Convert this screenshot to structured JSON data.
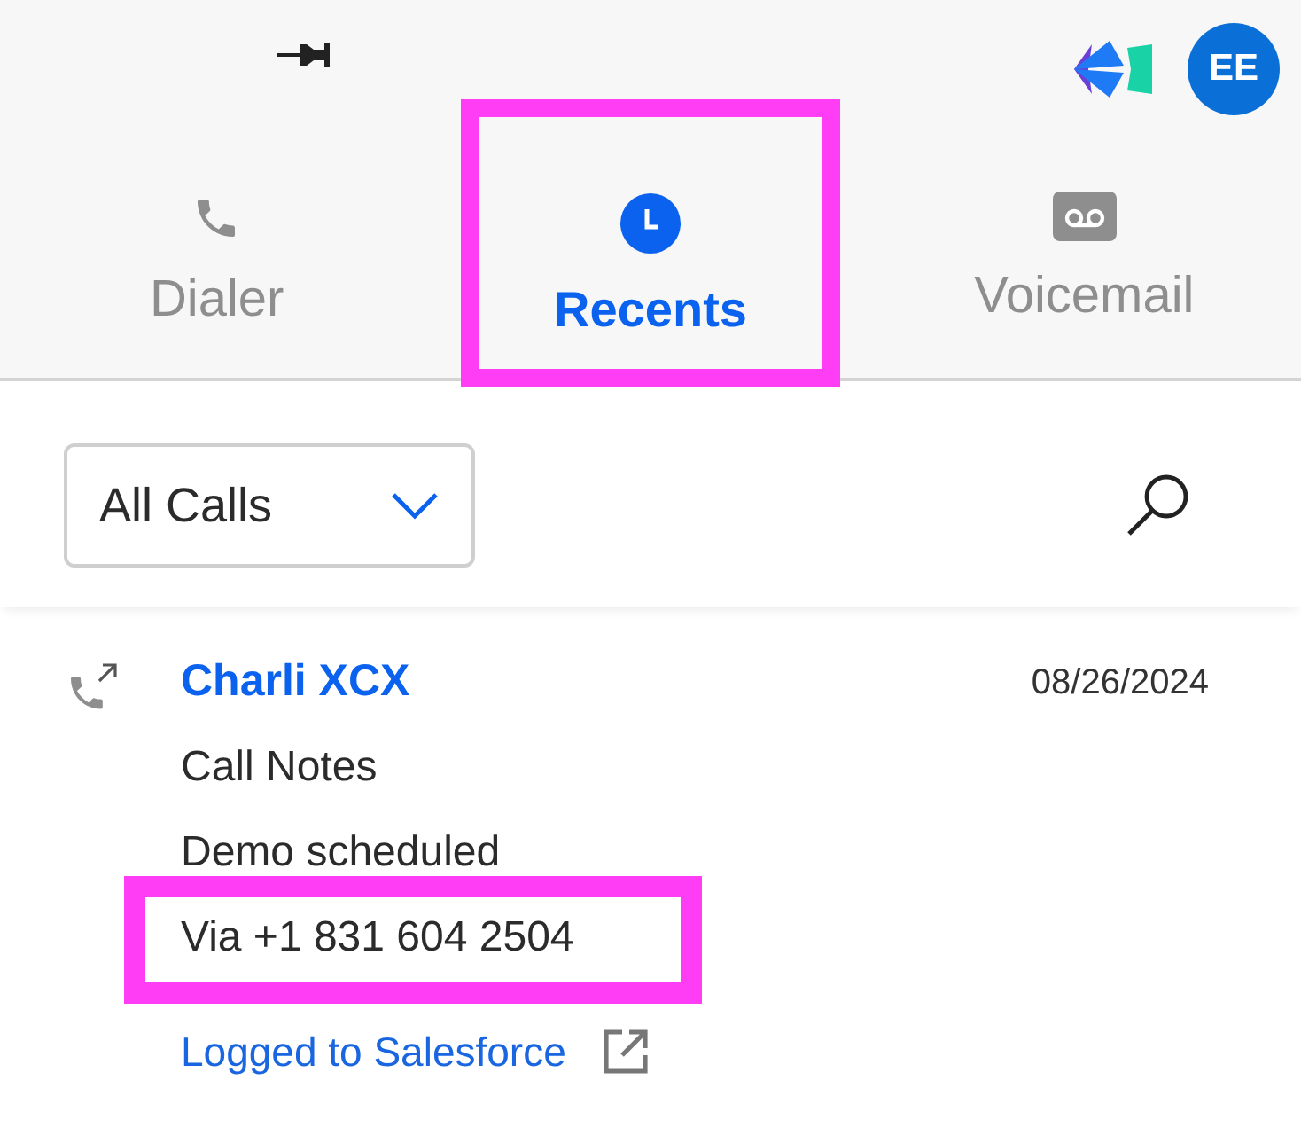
{
  "header": {
    "avatar": "EE"
  },
  "tabs": [
    {
      "kind": "phone",
      "label": "Dialer",
      "selected": false,
      "highlighted": false
    },
    {
      "kind": "clock",
      "label": "Recents",
      "selected": true,
      "highlighted": true
    },
    {
      "kind": "voicemail",
      "label": "Voicemail",
      "selected": false,
      "highlighted": false
    }
  ],
  "filter": {
    "value": "All Calls"
  },
  "calls": [
    {
      "name": "Charli XCX",
      "date": "08/26/2024",
      "lines": [
        {
          "text": "Call Notes",
          "highlighted": false
        },
        {
          "text": "Demo scheduled",
          "highlighted": false
        },
        {
          "text": "Via +1 831 604 2504",
          "highlighted": true
        }
      ],
      "link": "Logged to Salesforce"
    }
  ]
}
